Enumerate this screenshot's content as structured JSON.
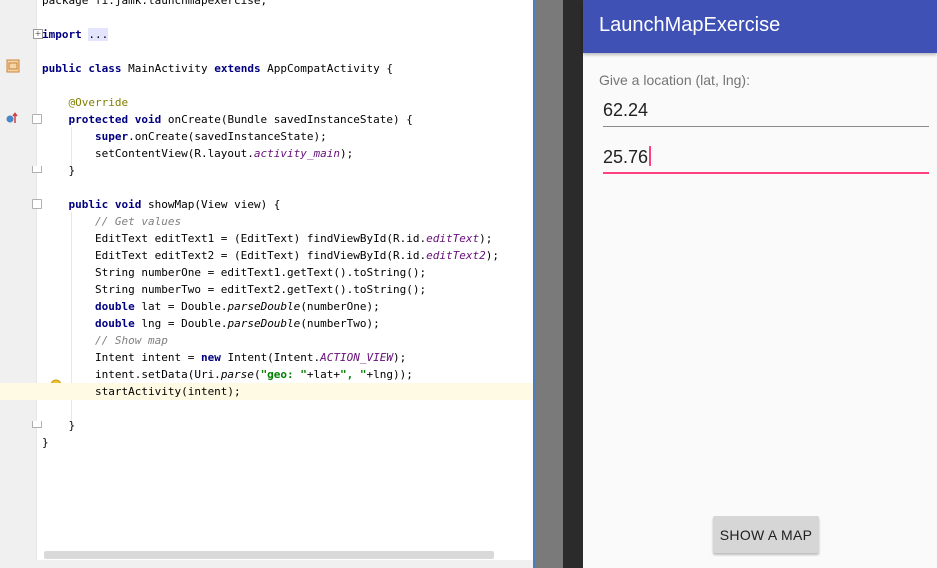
{
  "editor": {
    "lines": [
      {
        "segments": [
          {
            "t": "package fi.jamk.launchmapexercise;",
            "c": ""
          }
        ]
      },
      {
        "segments": [
          {
            "t": "import",
            "c": "kw"
          },
          {
            "t": " ",
            "c": ""
          },
          {
            "t": "...",
            "c": "fold-text"
          }
        ]
      },
      {
        "segments": [
          {
            "t": "public class",
            "c": "kw"
          },
          {
            "t": " MainActivity ",
            "c": ""
          },
          {
            "t": "extends",
            "c": "kw"
          },
          {
            "t": " AppCompatActivity {",
            "c": ""
          }
        ]
      },
      {
        "segments": [
          {
            "t": "    @Override",
            "c": "ann"
          }
        ]
      },
      {
        "segments": [
          {
            "t": "    ",
            "c": ""
          },
          {
            "t": "protected void",
            "c": "kw"
          },
          {
            "t": " onCreate(Bundle savedInstanceState) {",
            "c": ""
          }
        ]
      },
      {
        "segments": [
          {
            "t": "        ",
            "c": ""
          },
          {
            "t": "super",
            "c": "kw"
          },
          {
            "t": ".onCreate(savedInstanceState);",
            "c": ""
          }
        ]
      },
      {
        "segments": [
          {
            "t": "        setContentView(R.layout.",
            "c": ""
          },
          {
            "t": "activity_main",
            "c": "fld"
          },
          {
            "t": ");",
            "c": ""
          }
        ]
      },
      {
        "segments": [
          {
            "t": "    }",
            "c": ""
          }
        ]
      },
      {
        "segments": [
          {
            "t": "    ",
            "c": ""
          },
          {
            "t": "public void",
            "c": "kw"
          },
          {
            "t": " showMap(View view) {",
            "c": ""
          }
        ]
      },
      {
        "segments": [
          {
            "t": "        // Get values",
            "c": "cm"
          }
        ]
      },
      {
        "segments": [
          {
            "t": "        EditText editText1 = (EditText) findViewById(R.id.",
            "c": ""
          },
          {
            "t": "editText",
            "c": "fld"
          },
          {
            "t": ");",
            "c": ""
          }
        ]
      },
      {
        "segments": [
          {
            "t": "        EditText editText2 = (EditText) findViewById(R.id.",
            "c": ""
          },
          {
            "t": "editText2",
            "c": "fld"
          },
          {
            "t": ");",
            "c": ""
          }
        ]
      },
      {
        "segments": [
          {
            "t": "        String numberOne = editText1.getText().toString();",
            "c": ""
          }
        ]
      },
      {
        "segments": [
          {
            "t": "        String numberTwo = editText2.getText().toString();",
            "c": ""
          }
        ]
      },
      {
        "segments": [
          {
            "t": "        ",
            "c": ""
          },
          {
            "t": "double",
            "c": "kw"
          },
          {
            "t": " lat = Double.",
            "c": ""
          },
          {
            "t": "parseDouble",
            "c": "sm"
          },
          {
            "t": "(numberOne);",
            "c": ""
          }
        ]
      },
      {
        "segments": [
          {
            "t": "        ",
            "c": ""
          },
          {
            "t": "double",
            "c": "kw"
          },
          {
            "t": " lng = Double.",
            "c": ""
          },
          {
            "t": "parseDouble",
            "c": "sm"
          },
          {
            "t": "(numberTwo);",
            "c": ""
          }
        ]
      },
      {
        "segments": [
          {
            "t": "        // Show map",
            "c": "cm"
          }
        ]
      },
      {
        "segments": [
          {
            "t": "        Intent intent = ",
            "c": ""
          },
          {
            "t": "new",
            "c": "kw"
          },
          {
            "t": " Intent(Intent.",
            "c": ""
          },
          {
            "t": "ACTION_VIEW",
            "c": "fld"
          },
          {
            "t": ");",
            "c": ""
          }
        ]
      },
      {
        "segments": [
          {
            "t": "        intent.setData(Uri.",
            "c": ""
          },
          {
            "t": "parse",
            "c": "sm"
          },
          {
            "t": "(",
            "c": ""
          },
          {
            "t": "\"geo: \"",
            "c": "st"
          },
          {
            "t": "+lat+",
            "c": ""
          },
          {
            "t": "\", \"",
            "c": "st"
          },
          {
            "t": "+lng));",
            "c": ""
          }
        ]
      },
      {
        "segments": [
          {
            "t": "        startActivity(intent);",
            "c": ""
          }
        ]
      },
      {
        "segments": [
          {
            "t": "    }",
            "c": ""
          }
        ]
      },
      {
        "segments": [
          {
            "t": "}",
            "c": ""
          }
        ]
      }
    ]
  },
  "app": {
    "title": "LaunchMapExercise",
    "prompt": "Give a location (lat, lng):",
    "lat_value": "62.24",
    "lng_value": "25.76",
    "button_label": "SHOW A MAP",
    "colors": {
      "primary": "#3f51b5",
      "accent": "#ff4081"
    }
  }
}
